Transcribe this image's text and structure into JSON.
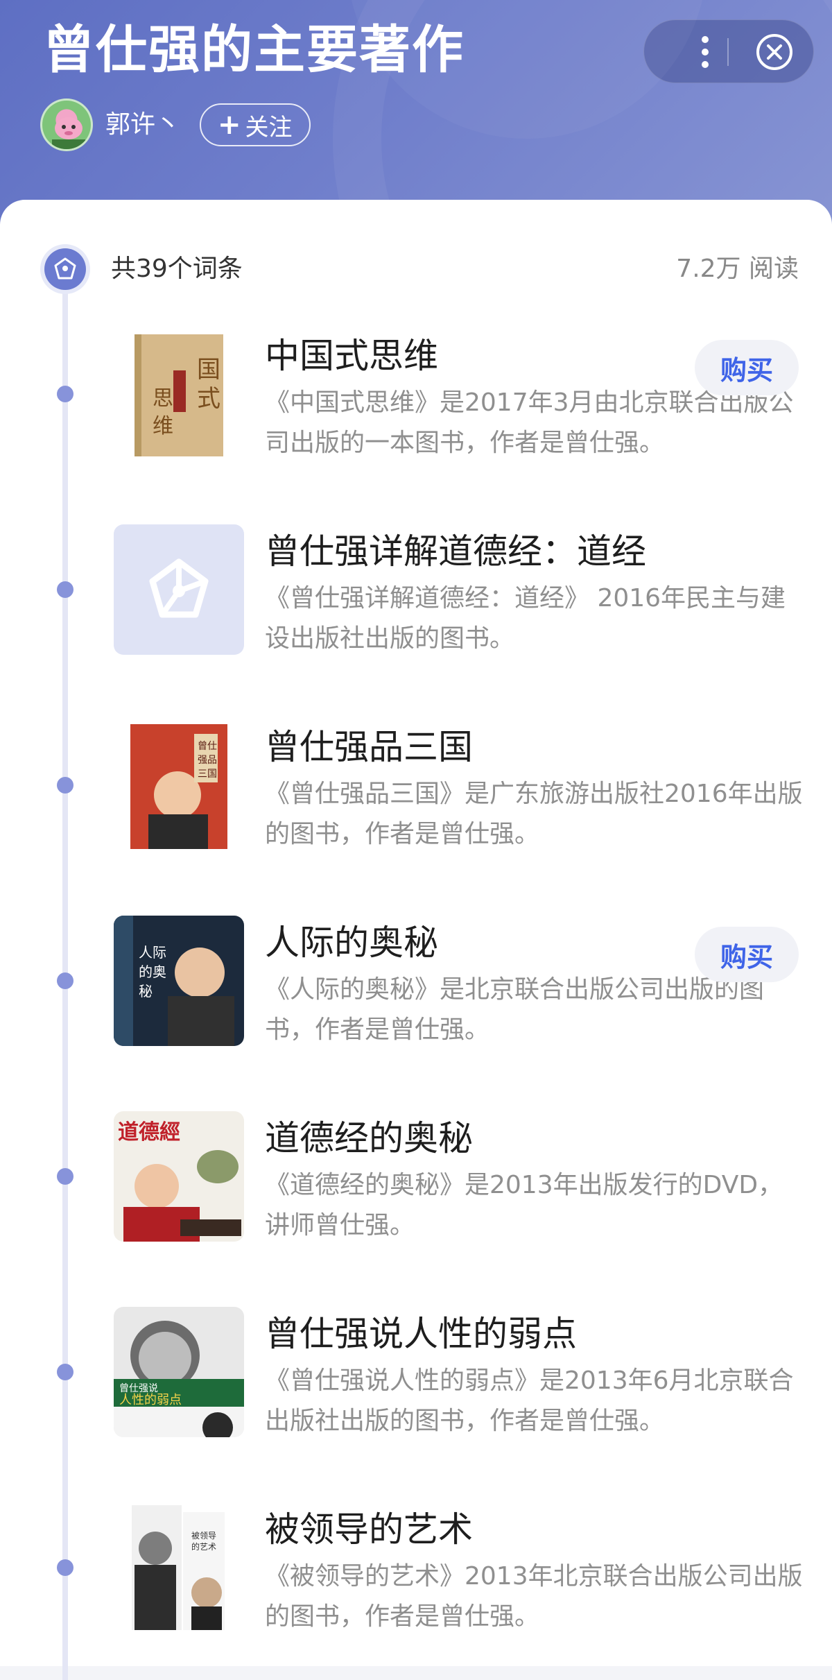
{
  "header": {
    "title": "曾仕强的主要著作",
    "author_name": "郭许丶",
    "follow_label": "关注",
    "follow_plus": "+",
    "more_icon": "more-vertical-icon",
    "close_icon": "close-circle-icon"
  },
  "summary": {
    "count_label": "共39个词条",
    "reads_label": "7.2万 阅读"
  },
  "entries": [
    {
      "title": "中国式思维",
      "desc": "《中国式思维》是2017年3月由北京联合出版公司出版的一本图书，作者是曾仕强。",
      "buy_label": "购买",
      "cover_text": "中国式思维"
    },
    {
      "title": "曾仕强详解道德经：道经",
      "desc": "《曾仕强详解道德经：道经》 2016年民主与建设出版社出版的图书。",
      "cover_text": ""
    },
    {
      "title": "曾仕强品三国",
      "desc": "《曾仕强品三国》是广东旅游出版社2016年出版的图书，作者是曾仕强。",
      "cover_text": "曾仕强品三国"
    },
    {
      "title": "人际的奥秘",
      "desc": "《人际的奥秘》是北京联合出版公司出版的图书，作者是曾仕强。",
      "buy_label": "购买",
      "cover_text": "人际的奥秘"
    },
    {
      "title": "道德经的奥秘",
      "desc": "《道德经的奥秘》是2013年出版发行的DVD，讲师曾仕强。",
      "cover_text": "道德經的奥秘"
    },
    {
      "title": "曾仕强说人性的弱点",
      "desc": "《曾仕强说人性的弱点》是2013年6月北京联合出版社出版的图书，作者是曾仕强。",
      "cover_text": "人性的弱点"
    },
    {
      "title": "被领导的艺术",
      "desc": "《被领导的艺术》2013年北京联合出版公司出版的图书，作者是曾仕强。",
      "cover_text": "被领导的艺术"
    }
  ],
  "colors": {
    "header_gradient_start": "#5e6fc3",
    "accent": "#6b7bd0",
    "buy_text": "#3f64e8",
    "timeline_dot": "#8793da"
  }
}
